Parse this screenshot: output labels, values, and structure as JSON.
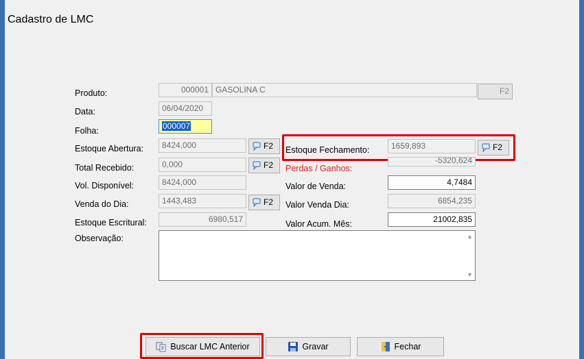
{
  "window": {
    "title": "Cadastro de LMC"
  },
  "form": {
    "produto": {
      "label": "Produto:",
      "codigo": "000001",
      "descricao": "GASOLINA C",
      "f2": "F2"
    },
    "data": {
      "label": "Data:",
      "value": "06/04/2020"
    },
    "folha": {
      "label": "Folha:",
      "value": "000007"
    },
    "estoque_abertura": {
      "label": "Estoque Abertura:",
      "value": "8424,000",
      "f2": "F2"
    },
    "total_recebido": {
      "label": "Total Recebido:",
      "value": "0,000",
      "f2": "F2"
    },
    "vol_disponivel": {
      "label": "Vol. Disponível:",
      "value": "8424,000"
    },
    "venda_do_dia": {
      "label": "Venda do Dia:",
      "value": "1443,483",
      "f2": "F2"
    },
    "estoque_escritural": {
      "label": "Estoque Escritural:",
      "value": "6980,517"
    },
    "observacao": {
      "label": "Observação:",
      "value": ""
    },
    "estoque_fechamento": {
      "label": "Estoque Fechamento:",
      "value": "1659,893",
      "f2": "F2"
    },
    "perdas_ganhos": {
      "label": "Perdas / Ganhos:",
      "value": "-5320,624",
      "color": "#e0201a"
    },
    "valor_de_venda": {
      "label": "Valor de Venda:",
      "value": "4,7484"
    },
    "valor_venda_dia": {
      "label": "Valor Venda Dia:",
      "value": "6854,235"
    },
    "valor_acum_mes": {
      "label": "Valor Acum. Mês:",
      "value": "21002,835"
    }
  },
  "buttons": {
    "buscar": "Buscar LMC Anterior",
    "gravar": "Gravar",
    "fechar": "Fechar"
  },
  "highlight_color": "#e00000",
  "icons": [
    "search-icon",
    "save-icon",
    "door-icon",
    "copy-icon",
    "scroll-up-icon",
    "scroll-down-icon"
  ]
}
